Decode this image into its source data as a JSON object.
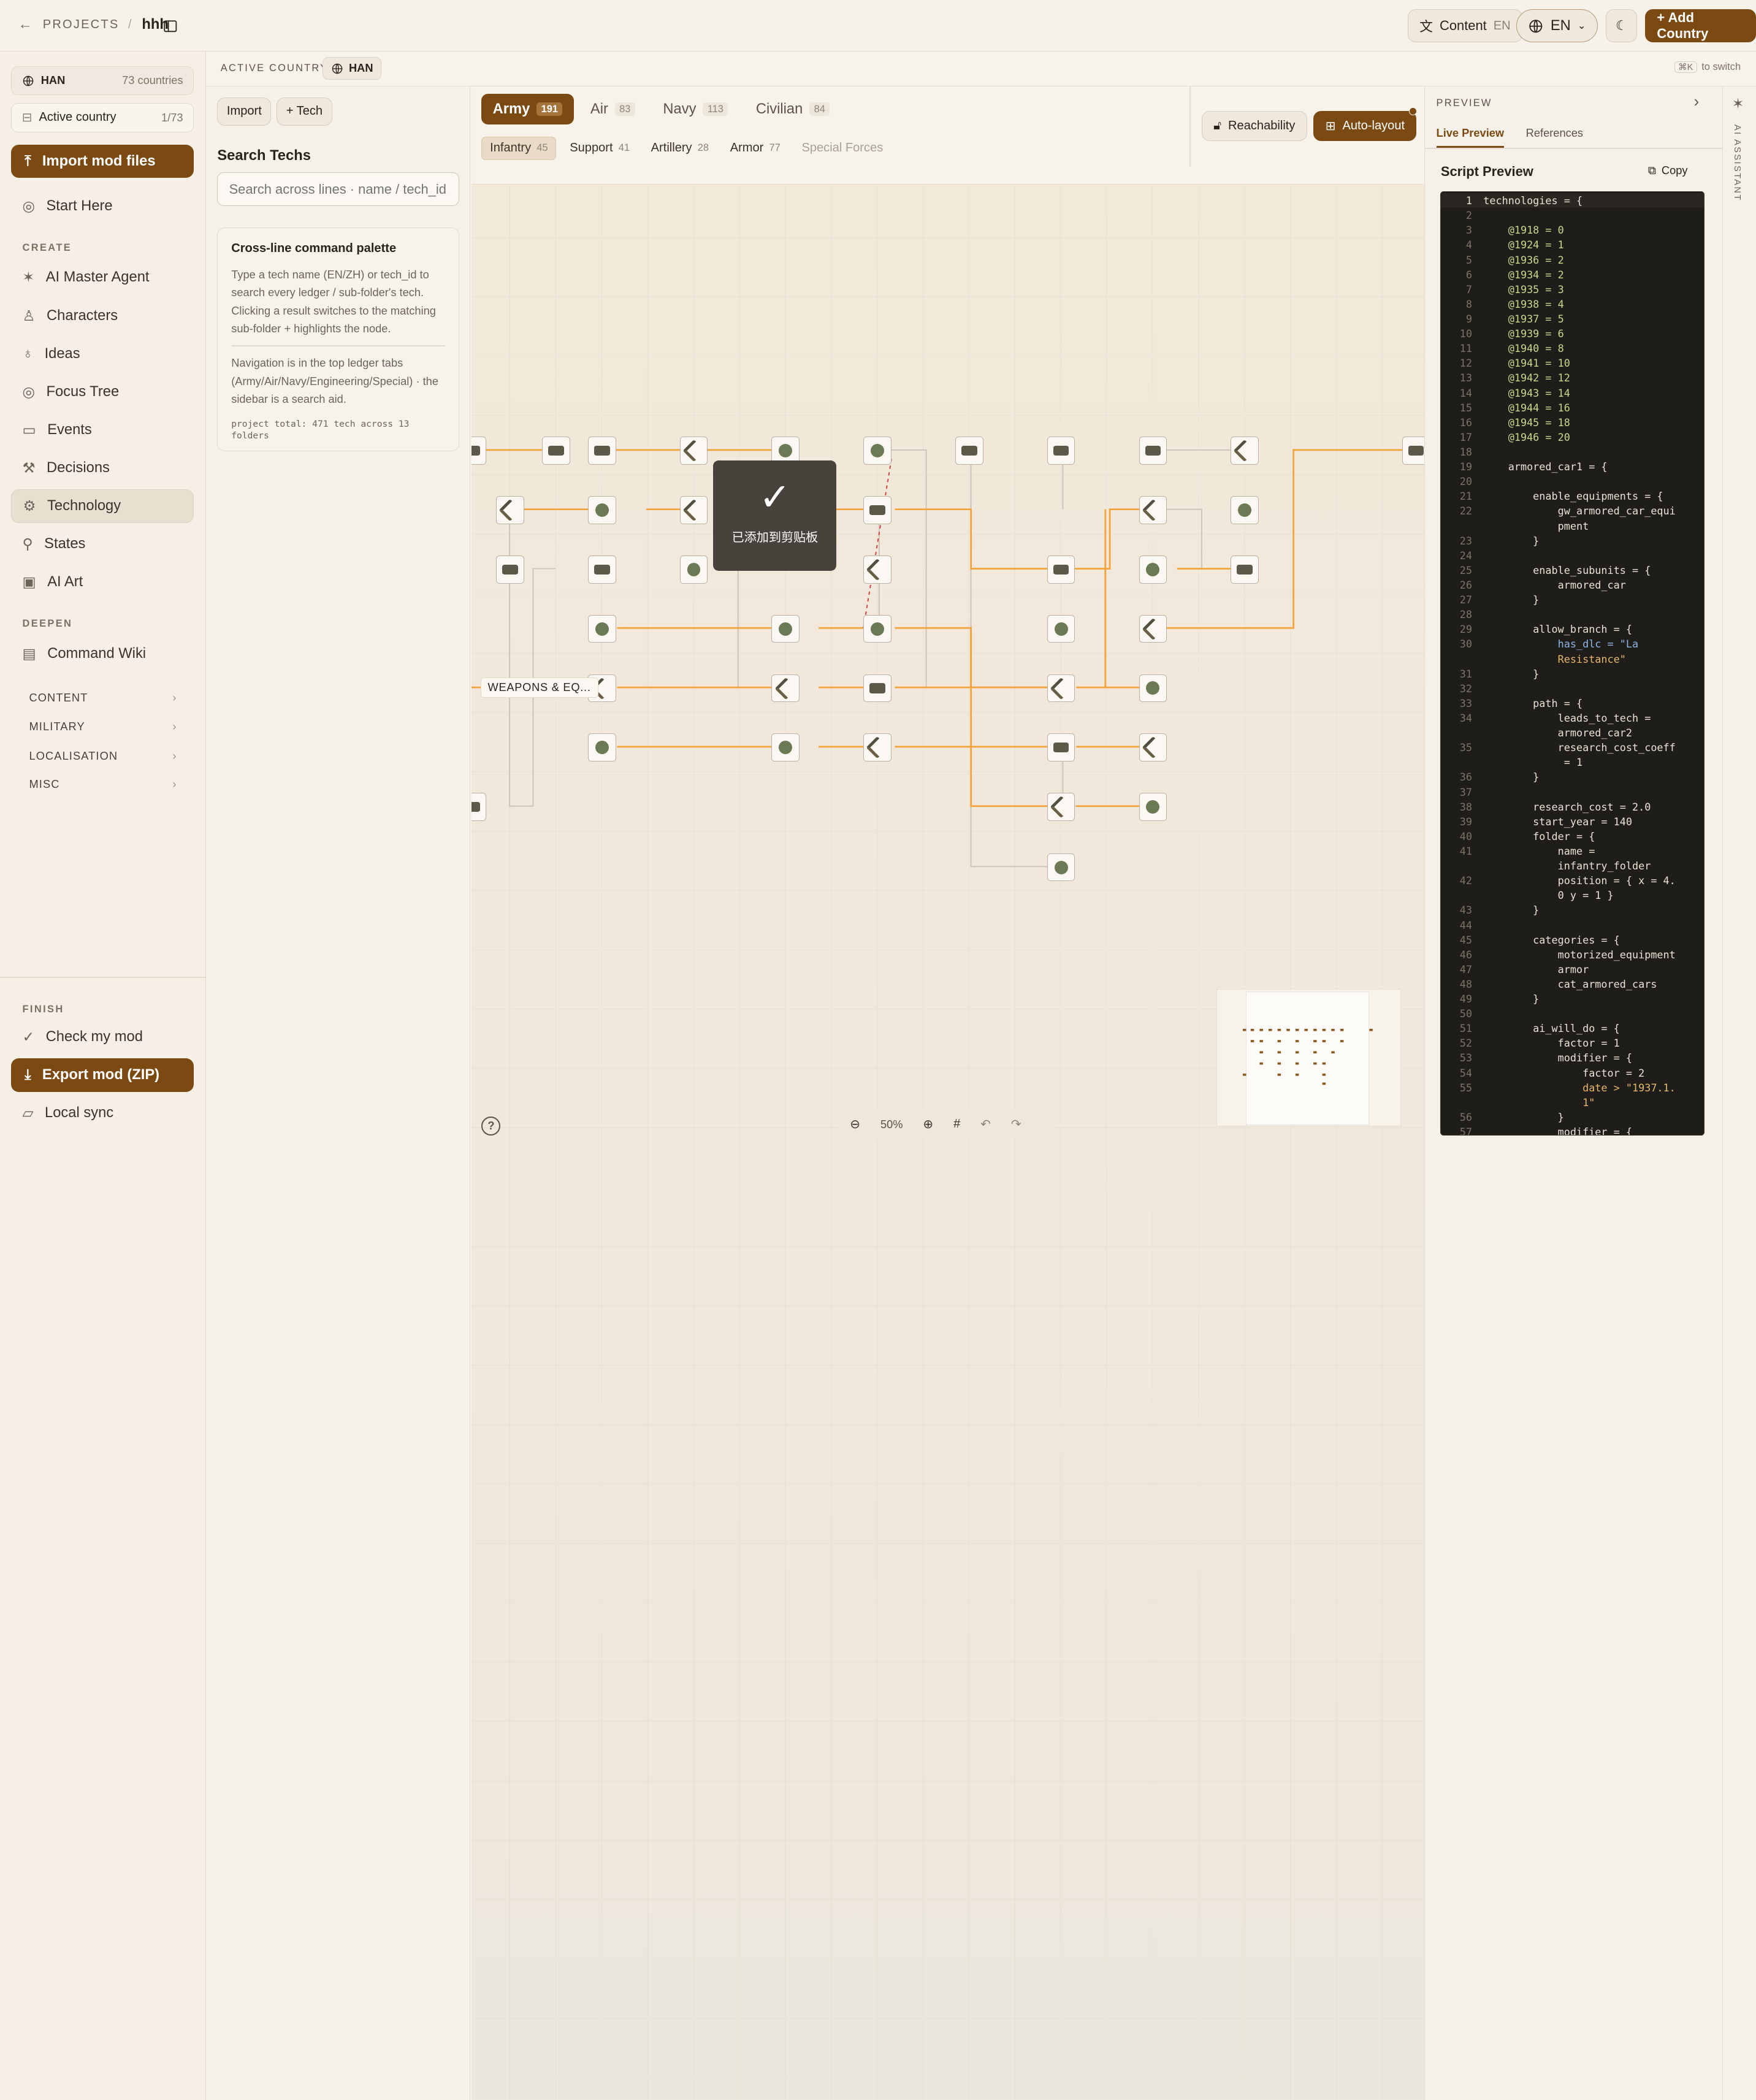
{
  "topbar": {
    "back_label": "PROJECTS",
    "separator": "/",
    "project_name": "hhh",
    "content_label": "Content",
    "content_lang": "EN",
    "lang_label": "EN",
    "add_country_label": "+ Add Country"
  },
  "sidebar": {
    "country_code": "HAN",
    "country_count": "73 countries",
    "active_country_label": "Active country",
    "active_country_index": "1/73",
    "import_label": "Import mod files",
    "start_label": "Start Here",
    "create_label": "CREATE",
    "create_items": [
      "AI Master Agent",
      "Characters",
      "Ideas",
      "Focus Tree",
      "Events",
      "Decisions",
      "Technology",
      "States",
      "AI Art"
    ],
    "deepen_label": "DEEPEN",
    "command_wiki": "Command Wiki",
    "sections": [
      "CONTENT",
      "MILITARY",
      "LOCALISATION",
      "MISC"
    ],
    "finish_label": "FINISH",
    "check_label": "Check my mod",
    "export_label": "Export mod (ZIP)",
    "sync_label": "Local sync"
  },
  "subheader": {
    "active_country_label": "ACTIVE COUNTRY",
    "country": "HAN",
    "shortcut": "⌘K",
    "shortcut_hint": "to switch"
  },
  "search_panel": {
    "import_label": "Import",
    "tech_label": "+ Tech",
    "title": "Search Techs",
    "placeholder": "Search across lines · name / tech_id...",
    "help_title": "Cross-line command palette",
    "help_body": "Type a tech name (EN/ZH) or tech_id to search every ledger / sub-folder's tech. Clicking a result switches to the matching sub-folder + highlights the node.",
    "nav_body": "Navigation is in the top ledger tabs (Army/Air/Navy/Engineering/Special) · the sidebar is a search aid.",
    "footer": "project total: 471 tech across 13 folders"
  },
  "ledger_tabs": [
    {
      "label": "Army",
      "count": "191"
    },
    {
      "label": "Air",
      "count": "83"
    },
    {
      "label": "Navy",
      "count": "113"
    },
    {
      "label": "Civilian",
      "count": "84"
    }
  ],
  "sub_tabs": [
    {
      "label": "Infantry",
      "count": "45"
    },
    {
      "label": "Support",
      "count": "41"
    },
    {
      "label": "Artillery",
      "count": "28"
    },
    {
      "label": "Armor",
      "count": "77"
    },
    {
      "label": "Special Forces",
      "count": ""
    }
  ],
  "toolbar": {
    "reachability": "Reachability",
    "auto_layout": "Auto-layout"
  },
  "canvas": {
    "folder_label": "WEAPONS & EQ...",
    "toast": "已添加到剪贴板",
    "zoom": "50%",
    "help": "?"
  },
  "preview": {
    "header": "PREVIEW",
    "tab_live": "Live Preview",
    "tab_refs": "References",
    "script_title": "Script Preview",
    "copy_label": "Copy",
    "code_lines": [
      "technologies = {",
      "",
      "    @1918 = 0",
      "    @1924 = 1",
      "    @1936 = 2",
      "    @1934 = 2",
      "    @1935 = 3",
      "    @1938 = 4",
      "    @1937 = 5",
      "    @1939 = 6",
      "    @1940 = 8",
      "    @1941 = 10",
      "    @1942 = 12",
      "    @1943 = 14",
      "    @1944 = 16",
      "    @1945 = 18",
      "    @1946 = 20",
      "",
      "    armored_car1 = {",
      "",
      "        enable_equipments = {",
      "            gw_armored_car_equi",
      "            pment",
      "        }",
      "",
      "        enable_subunits = {",
      "            armored_car",
      "        }",
      "",
      "        allow_branch = {",
      "            has_dlc = \"La",
      "            Resistance\"",
      "        }",
      "",
      "        path = {",
      "            leads_to_tech =",
      "            armored_car2",
      "            research_cost_coeff",
      "             = 1",
      "        }",
      "",
      "        research_cost = 2.0",
      "        start_year = 140",
      "        folder = {",
      "            name =",
      "            infantry_folder",
      "            position = { x = 4.",
      "            0 y = 1 }",
      "        }",
      "",
      "        categories = {",
      "            motorized_equipment",
      "            armor",
      "            cat_armored_cars",
      "        }",
      "",
      "        ai_will_do = {",
      "            factor = 1",
      "            modifier = {",
      "                factor = 2",
      "                date > \"1937.1.",
      "                1\"",
      "            }",
      "            modifier = {"
    ],
    "line_numbers": [
      "1",
      "2",
      "3",
      "4",
      "5",
      "6",
      "7",
      "8",
      "9",
      "10",
      "11",
      "12",
      "13",
      "14",
      "15",
      "16",
      "17",
      "18",
      "19",
      "20",
      "21",
      "22",
      "",
      "23",
      "24",
      "25",
      "26",
      "27",
      "28",
      "29",
      "30",
      "",
      "31",
      "32",
      "33",
      "34",
      "",
      "35",
      "",
      "36",
      "37",
      "38",
      "39",
      "40",
      "41",
      "",
      "42",
      "",
      "43",
      "44",
      "45",
      "46",
      "47",
      "48",
      "49",
      "50",
      "51",
      "52",
      "53",
      "54",
      "55",
      "",
      "56",
      "57"
    ]
  },
  "assistant": {
    "label": "AI ASSISTANT"
  }
}
